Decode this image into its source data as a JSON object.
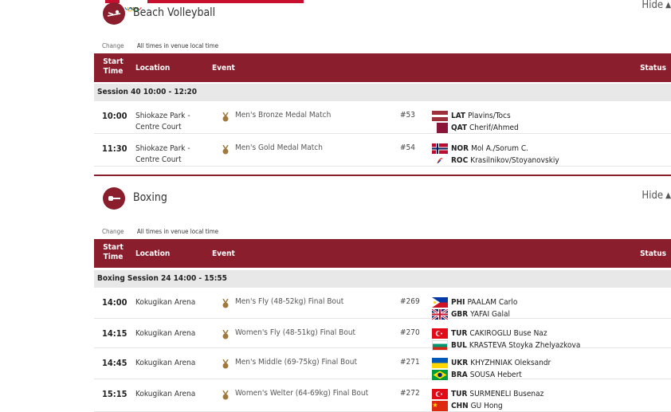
{
  "colors": {
    "header_bg": "#8b1e2d",
    "session_bg": "#e8e8e8",
    "bronze": "#a07a3c"
  },
  "column_headers": {
    "start": "Start Time",
    "location": "Location",
    "event": "Event",
    "status": "Status"
  },
  "sections": [
    {
      "sport": "Beach Volleyball",
      "icon": "beach-volleyball-icon",
      "hide_label": "Hide",
      "change_label": "Change",
      "times_note": "All times in venue local time",
      "session_title": "Session 40  10:00 - 12:20",
      "rows": [
        {
          "time": "10:00",
          "location": "Shiokaze Park - Centre Court",
          "event": "Men's Bronze Medal Match",
          "number": "#53",
          "teams": [
            {
              "code": "LAT",
              "name": "Plavins/Tocs",
              "flag": "latvia-flag"
            },
            {
              "code": "QAT",
              "name": "Cherif/Ahmed",
              "flag": "qatar-flag"
            }
          ]
        },
        {
          "time": "11:30",
          "location": "Shiokaze Park - Centre Court",
          "event": "Men's Gold Medal Match",
          "number": "#54",
          "teams": [
            {
              "code": "NOR",
              "name": "Mol A./Sorum C.",
              "flag": "norway-flag"
            },
            {
              "code": "ROC",
              "name": "Krasilnikov/Stoyanovskiy",
              "flag": "roc-flag"
            }
          ]
        }
      ]
    },
    {
      "sport": "Boxing",
      "icon": "boxing-icon",
      "hide_label": "Hide",
      "change_label": "Change",
      "times_note": "All times in venue local time",
      "session_title": "Boxing Session 24  14:00 - 15:55",
      "rows": [
        {
          "time": "14:00",
          "location": "Kokugikan Arena",
          "event": "Men's Fly (48-52kg) Final Bout",
          "number": "#269",
          "teams": [
            {
              "code": "PHI",
              "name": "PAALAM Carlo",
              "flag": "philippines-flag"
            },
            {
              "code": "GBR",
              "name": "YAFAI Galal",
              "flag": "uk-flag"
            }
          ]
        },
        {
          "time": "14:15",
          "location": "Kokugikan Arena",
          "event": "Women's Fly (48-51kg) Final Bout",
          "number": "#270",
          "teams": [
            {
              "code": "TUR",
              "name": "CAKIROGLU Buse Naz",
              "flag": "turkey-flag"
            },
            {
              "code": "BUL",
              "name": "KRASTEVA Stoyka Zhelyazkova",
              "flag": "bulgaria-flag"
            }
          ]
        },
        {
          "time": "14:45",
          "location": "Kokugikan Arena",
          "event": "Men's Middle (69-75kg) Final Bout",
          "number": "#271",
          "teams": [
            {
              "code": "UKR",
              "name": "KHYZHNIAK Oleksandr",
              "flag": "ukraine-flag"
            },
            {
              "code": "BRA",
              "name": "SOUSA Hebert",
              "flag": "brazil-flag"
            }
          ]
        },
        {
          "time": "15:15",
          "location": "Kokugikan Arena",
          "event": "Women's Welter (64-69kg) Final Bout",
          "number": "#272",
          "teams": [
            {
              "code": "TUR",
              "name": "SURMENELI Busenaz",
              "flag": "turkey-flag"
            },
            {
              "code": "CHN",
              "name": "GU Hong",
              "flag": "china-flag"
            }
          ]
        }
      ]
    }
  ]
}
